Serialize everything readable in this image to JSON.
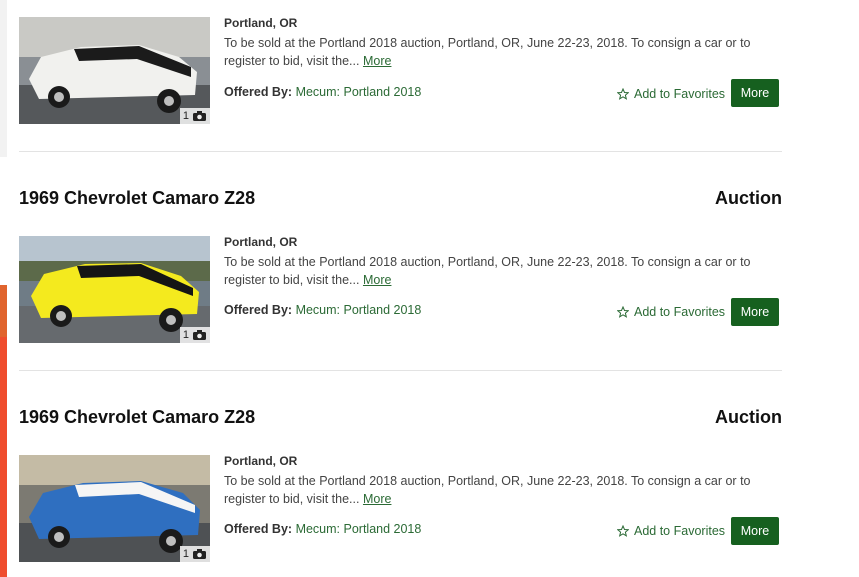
{
  "listings": [
    {
      "title": "",
      "type": "",
      "location": "Portland, OR",
      "description": "To be sold at the Portland 2018 auction, Portland, OR, June 22-23, 2018. To consign a car or to register to bid, visit the...",
      "more_link": "More",
      "offered_by_label": "Offered By:",
      "seller": "Mecum: Portland 2018",
      "photo_count": "1",
      "favorite_label": "Add to Favorites",
      "more_button": "More",
      "car_color": "#f1f1ee",
      "stripe_color": "#1b1b1b"
    },
    {
      "title": "1969 Chevrolet Camaro Z28",
      "type": "Auction",
      "location": "Portland, OR",
      "description": "To be sold at the Portland 2018 auction, Portland, OR, June 22-23, 2018. To consign a car or to register to bid, visit the...",
      "more_link": "More",
      "offered_by_label": "Offered By:",
      "seller": "Mecum: Portland 2018",
      "photo_count": "1",
      "favorite_label": "Add to Favorites",
      "more_button": "More",
      "car_color": "#f4ea1e",
      "stripe_color": "#151515"
    },
    {
      "title": "1969 Chevrolet Camaro Z28",
      "type": "Auction",
      "location": "Portland, OR",
      "description": "To be sold at the Portland 2018 auction, Portland, OR, June 22-23, 2018. To consign a car or to register to bid, visit the...",
      "more_link": "More",
      "offered_by_label": "Offered By:",
      "seller": "Mecum: Portland 2018",
      "photo_count": "1",
      "favorite_label": "Add to Favorites",
      "more_button": "More",
      "car_color": "#2f6fc0",
      "stripe_color": "#f5f5f5"
    }
  ],
  "colors": {
    "accent": "#16601f",
    "link": "#2b6a35"
  },
  "icons": {
    "photo": "camera-icon",
    "favorite": "star-icon"
  }
}
